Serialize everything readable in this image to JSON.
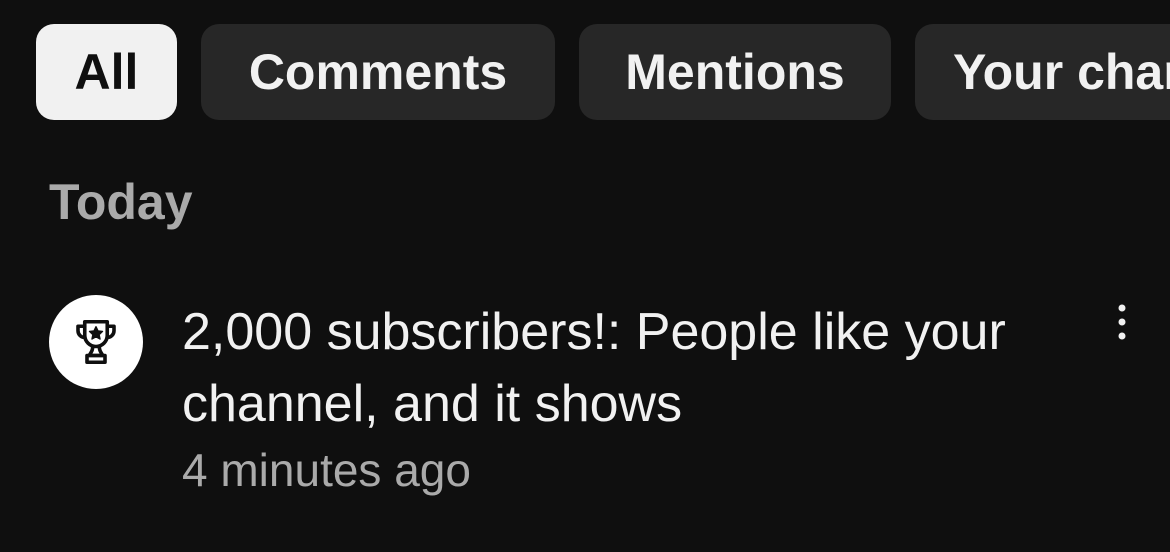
{
  "filter_chips": [
    {
      "label": "All",
      "selected": true
    },
    {
      "label": "Comments",
      "selected": false
    },
    {
      "label": "Mentions",
      "selected": false
    },
    {
      "label": "Your channel",
      "selected": false
    }
  ],
  "section": {
    "heading": "Today"
  },
  "notifications": [
    {
      "icon": "trophy-icon",
      "title": "2,000 subscribers!: People like your channel, and it shows",
      "time": "4 minutes ago"
    }
  ],
  "colors": {
    "background": "#0f0f0f",
    "chip_background": "#272727",
    "chip_selected_background": "#f1f1f1",
    "primary_text": "#f1f1f1",
    "secondary_text": "#aaaaaa"
  }
}
